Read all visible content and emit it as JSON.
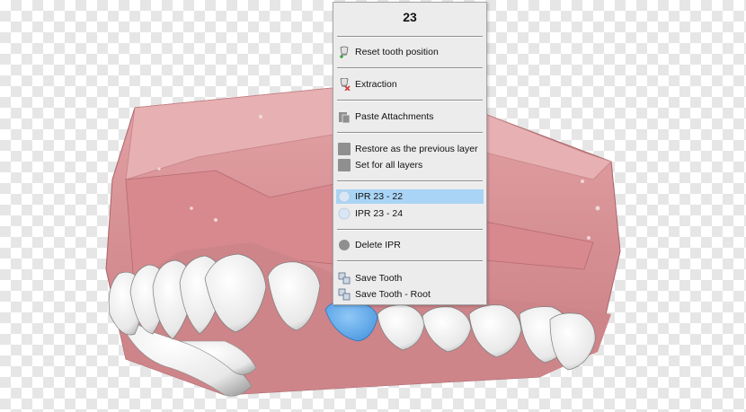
{
  "menu": {
    "title": "23",
    "items": [
      {
        "label": "Reset tooth position",
        "icon": "tooth-reset-icon"
      },
      {
        "label": "Extraction",
        "icon": "tooth-extraction-icon"
      },
      {
        "label": "Paste Attachments",
        "icon": "paste-icon"
      },
      {
        "label": "Restore as the previous layer",
        "icon": "restore-layer-icon"
      },
      {
        "label": "Set for all layers",
        "icon": "layers-icon"
      },
      {
        "label": "IPR 23 - 22",
        "icon": "ipr-circle-icon",
        "selected": true
      },
      {
        "label": "IPR 23 - 24",
        "icon": "ipr-circle-icon"
      },
      {
        "label": "Delete IPR",
        "icon": "delete-ipr-icon"
      },
      {
        "label": "Save Tooth",
        "icon": "save-tooth-icon"
      },
      {
        "label": "Save Tooth - Root",
        "icon": "save-tooth-root-icon"
      }
    ]
  },
  "colors": {
    "gum": "#d98e92",
    "gum_dark": "#b86a70",
    "tooth": "#f2f2f2",
    "selected_tooth": "#5aa9ee",
    "selected_row": "#a9d4f5"
  }
}
